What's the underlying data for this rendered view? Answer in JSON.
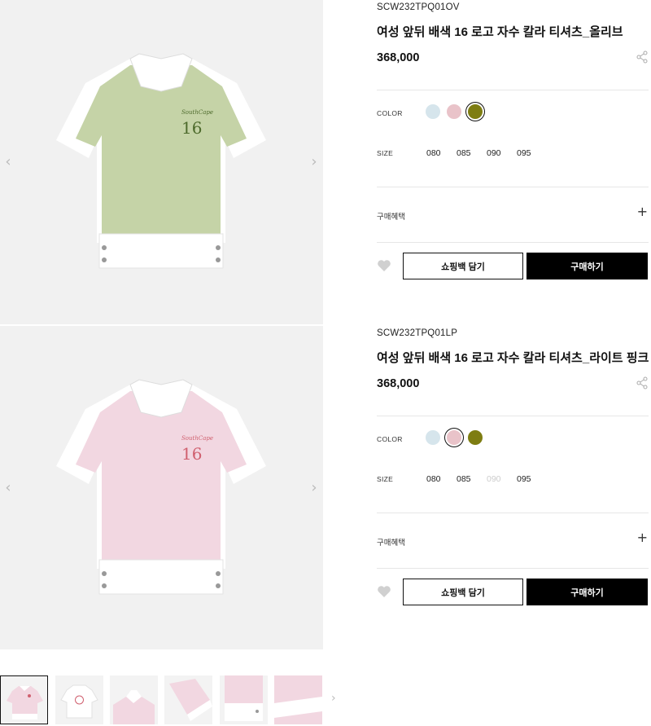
{
  "products": [
    {
      "sku": "SCW232TPQ01OV",
      "title": "여성 앞뒤 배색 16 로고 자수 칼라 티셔츠_올리브",
      "price": "368,000",
      "color_label": "COLOR",
      "size_label": "SIZE",
      "colors": [
        {
          "name": "light-blue",
          "hex": "#d6e5ec",
          "selected": false
        },
        {
          "name": "light-pink",
          "hex": "#e9c3c9",
          "selected": false
        },
        {
          "name": "olive",
          "hex": "#7e7d12",
          "selected": true
        }
      ],
      "sizes": [
        {
          "label": "080",
          "available": true
        },
        {
          "label": "085",
          "available": true
        },
        {
          "label": "090",
          "available": true
        },
        {
          "label": "095",
          "available": true
        }
      ],
      "benefit_label": "구매혜택",
      "bag_button": "쇼핑백 담기",
      "buy_button": "구매하기",
      "shirt_color": "#c5d3a7",
      "logo_script": "SouthCape",
      "logo_number": "16",
      "logo_color": "#4d6a2c"
    },
    {
      "sku": "SCW232TPQ01LP",
      "title": "여성 앞뒤 배색 16 로고 자수 칼라 티셔츠_라이트 핑크",
      "price": "368,000",
      "color_label": "COLOR",
      "size_label": "SIZE",
      "colors": [
        {
          "name": "light-blue",
          "hex": "#d6e5ec",
          "selected": false
        },
        {
          "name": "light-pink",
          "hex": "#e9c3c9",
          "selected": true
        },
        {
          "name": "olive",
          "hex": "#7e7d12",
          "selected": false
        }
      ],
      "sizes": [
        {
          "label": "080",
          "available": true
        },
        {
          "label": "085",
          "available": true
        },
        {
          "label": "090",
          "available": false
        },
        {
          "label": "095",
          "available": true
        }
      ],
      "benefit_label": "구매혜택",
      "bag_button": "쇼핑백 담기",
      "buy_button": "구매하기",
      "shirt_color": "#f2d7e1",
      "logo_script": "SouthCape",
      "logo_number": "16",
      "logo_color": "#d0606f"
    }
  ],
  "icons": {
    "prev": "chevron-left-icon",
    "next": "chevron-right-icon",
    "share": "share-icon",
    "wishlist": "heart-icon",
    "expand": "plus-icon"
  },
  "thumbnails": [
    {
      "name": "front-pink",
      "active": true
    },
    {
      "name": "front-white-logo",
      "active": false
    },
    {
      "name": "back-detail",
      "active": false
    },
    {
      "name": "sleeve-detail",
      "active": false
    },
    {
      "name": "hem-detail",
      "active": false
    },
    {
      "name": "fabric-detail",
      "active": false
    }
  ]
}
